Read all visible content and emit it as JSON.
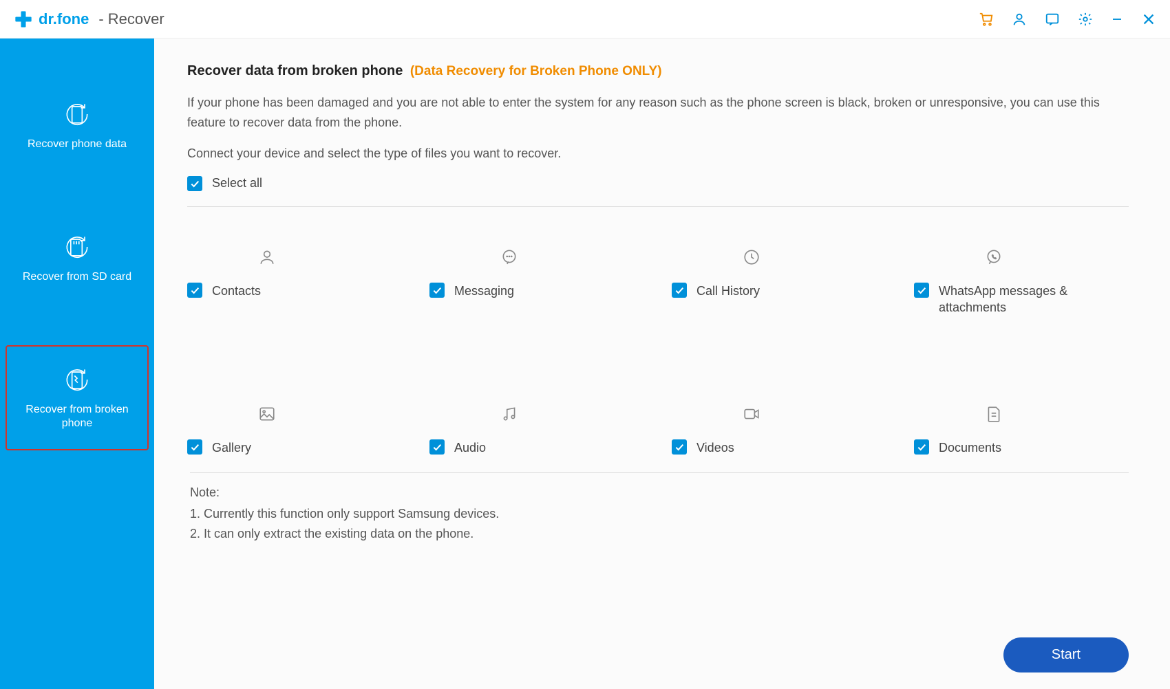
{
  "titlebar": {
    "brand": "dr.fone",
    "module": "- Recover"
  },
  "sidebar": {
    "items": [
      {
        "label": "Recover phone data"
      },
      {
        "label": "Recover from SD card"
      },
      {
        "label": "Recover from broken phone"
      }
    ]
  },
  "main": {
    "heading": "Recover data from broken phone",
    "heading_sub": "(Data Recovery for Broken Phone ONLY)",
    "description": "If your phone has been damaged and you are not able to enter the system for any reason such as the phone screen is black, broken or unresponsive, you can use this feature to recover data from the phone.",
    "description2": "Connect your device and select the type of files you want to recover.",
    "select_all_label": "Select all",
    "datatypes": [
      {
        "label": "Contacts",
        "icon": "person"
      },
      {
        "label": "Messaging",
        "icon": "chat"
      },
      {
        "label": "Call History",
        "icon": "clock"
      },
      {
        "label": "WhatsApp messages & attachments",
        "icon": "whatsapp"
      },
      {
        "label": "Gallery",
        "icon": "image"
      },
      {
        "label": "Audio",
        "icon": "music"
      },
      {
        "label": "Videos",
        "icon": "video"
      },
      {
        "label": "Documents",
        "icon": "doc"
      }
    ],
    "notes": {
      "title": "Note:",
      "line1": "1. Currently this function only support Samsung devices.",
      "line2": "2. It can only extract the existing data on the phone."
    },
    "start_label": "Start"
  }
}
